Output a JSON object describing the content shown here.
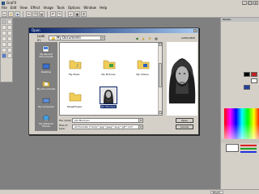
{
  "app": {
    "title": "GraFX",
    "menu": [
      "File",
      "Edit",
      "View",
      "Effect",
      "Image",
      "Tools",
      "Options",
      "Window",
      "Help"
    ]
  },
  "palette": {
    "title": "Palette",
    "bottom_tab": "Brush"
  },
  "dialog": {
    "title": "Open",
    "look_in_label": "Look in:",
    "look_in_value": "My Documents",
    "image_dims": "1265x1850",
    "places": [
      {
        "label": "My Recent Documents",
        "icon": "recent-documents-icon"
      },
      {
        "label": "Desktop",
        "icon": "desktop-icon"
      },
      {
        "label": "My Documents",
        "icon": "my-documents-icon"
      },
      {
        "label": "My Computer",
        "icon": "my-computer-icon"
      },
      {
        "label": "My Network Places",
        "icon": "network-places-icon"
      }
    ],
    "files": [
      {
        "label": "My Music",
        "type": "folder"
      },
      {
        "label": "My Pictures",
        "type": "folder"
      },
      {
        "label": "My Videos",
        "type": "folder"
      },
      {
        "label": "StrawFlower",
        "type": "folder"
      },
      {
        "label": "Jim Morrison",
        "type": "image"
      }
    ],
    "file_name_label": "File name:",
    "file_name_value": "Jim Morrison",
    "file_type_label": "Files of type:",
    "file_type_value": "All Formats (*.bmp;*.jpg;*.jpeg;*.png;*.gif;*.xcf)",
    "open_button": "Open",
    "cancel_button": "Cancel"
  },
  "colors": {
    "workspace": "#8c8c8c",
    "dialog_title_start": "#0a246a",
    "selection": "#0a246a",
    "folder": "#e8c44a"
  }
}
